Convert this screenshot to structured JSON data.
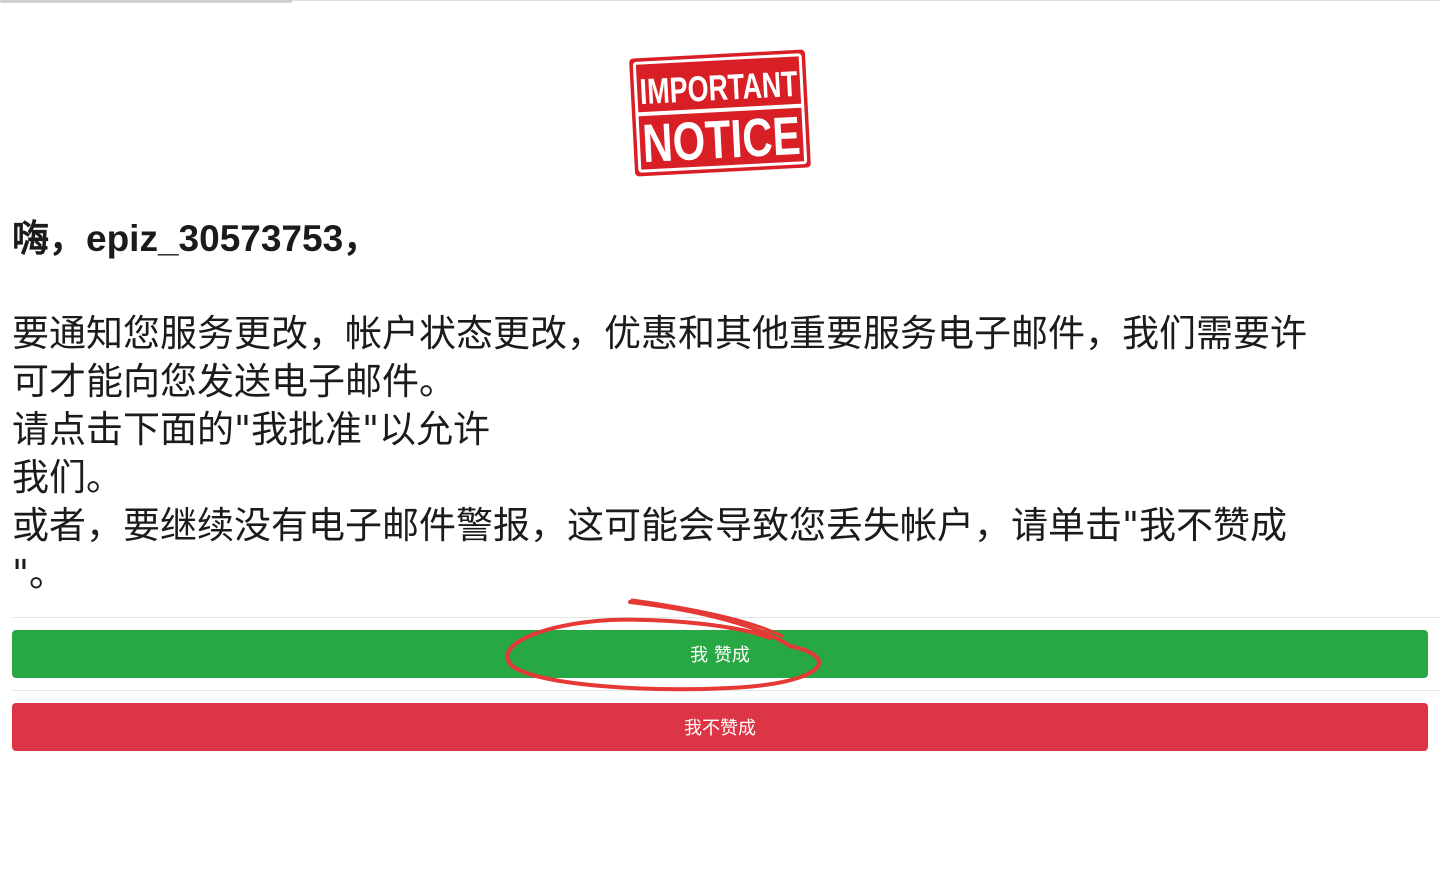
{
  "logo": {
    "line1": "IMPORTANT",
    "line2": "NOTICE",
    "color": "#d81f26"
  },
  "greeting": "嗨，epiz_30573753，",
  "message_lines": [
    "要通知您服务更改，帐户状态更改，优惠和其他重要服务电子邮件，我们需要许",
    "可才能向您发送电子邮件。",
    "请点击下面的\"我批准\"以允许",
    "我们。",
    "或者，要继续没有电子邮件警报，这可能会导致您丢失帐户，请单击\"我不赞成",
    "\"。"
  ],
  "buttons": {
    "approve_label": "我 赞成",
    "approve_color": "#28a745",
    "decline_label": "我不赞成",
    "decline_color": "#dc3545"
  },
  "annotation_color": "#e53935"
}
